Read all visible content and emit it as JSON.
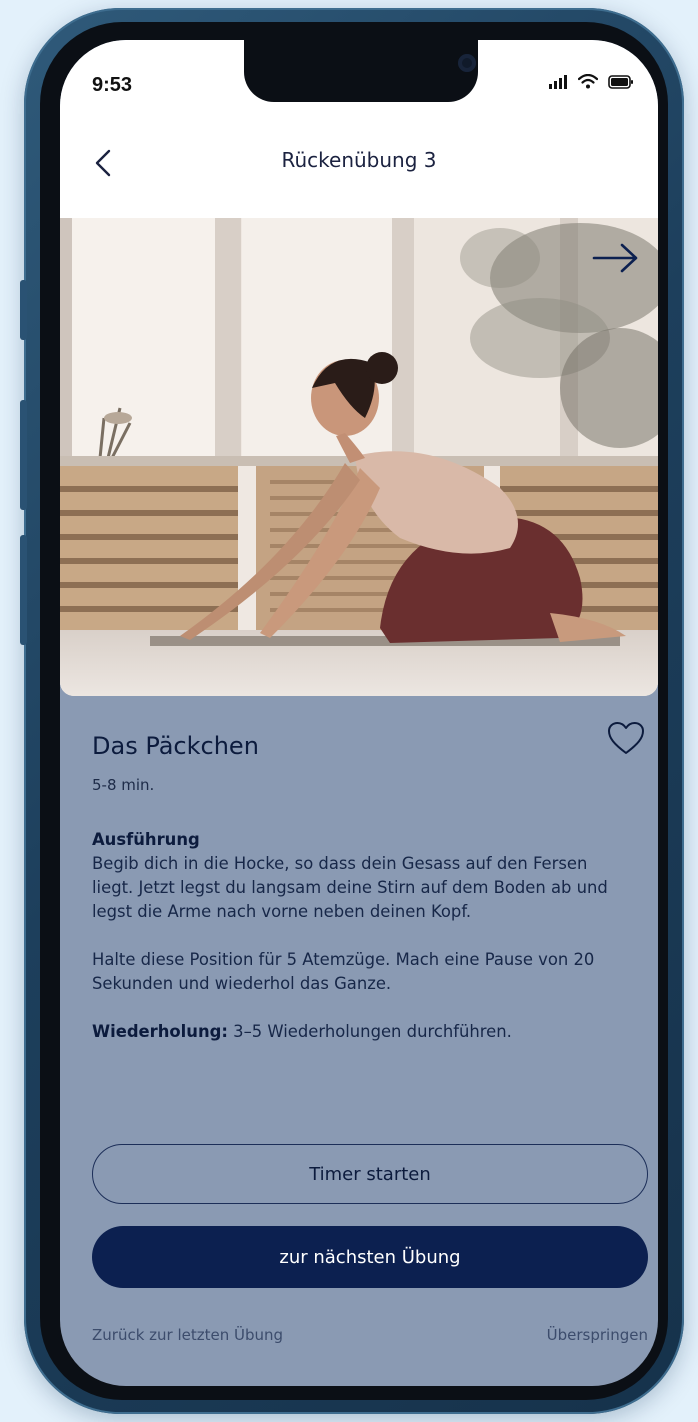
{
  "status_bar": {
    "time": "9:53",
    "icons": [
      "signal-bars-icon",
      "wifi-icon",
      "battery-icon"
    ]
  },
  "header": {
    "title": "Rückenübung 3",
    "back_icon": "chevron-left-icon"
  },
  "hero": {
    "next_icon": "arrow-right-icon"
  },
  "exercise": {
    "name": "Das Päckchen",
    "duration": "5-8 min.",
    "favorite_icon": "heart-outline-icon",
    "execution_heading": "Ausführung",
    "execution_text": "Begib dich in die Hocke, so dass dein Gesass auf den Fersen liegt. Jetzt legst du langsam deine Stirn auf dem Boden ab und legst die Arme nach vorne neben deinen Kopf.",
    "hold_text": "Halte diese Position für 5 Atemzüge. Mach eine Pause von 20 Sekunden und wiederhol das Ganze.",
    "repetition_label": "Wiederholung:",
    "repetition_text": "3–5 Wiederholungen durchführen."
  },
  "actions": {
    "timer_label": "Timer starten",
    "next_label": "zur nächsten Übung",
    "previous_label": "Zurück zur letzten Übung",
    "skip_label": "Überspringen"
  },
  "colors": {
    "page_background": "#e3f1fb",
    "phone_frame": "#1d3f5c",
    "content_background": "#8a9ab3",
    "primary": "#0c2050",
    "text_dark": "#0c1b3d"
  }
}
